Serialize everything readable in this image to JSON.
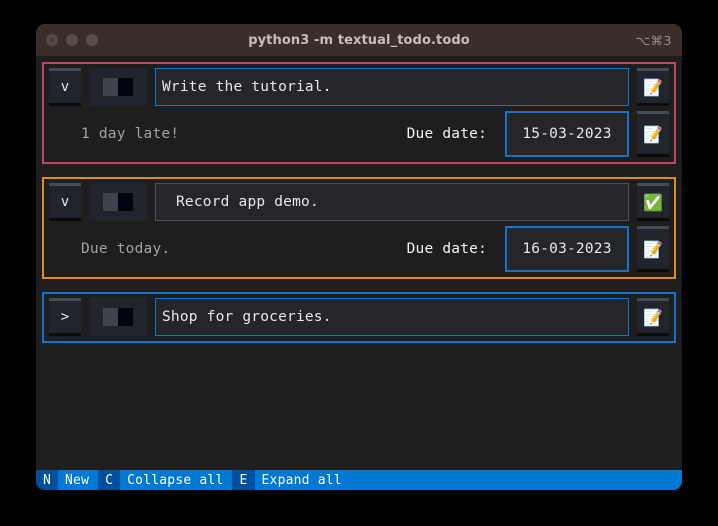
{
  "window": {
    "title": "python3 -m textual_todo.todo",
    "shortcut_hint": "⌥⌘3",
    "traffic_lights": [
      "close-dot",
      "minimize-dot",
      "zoom-dot"
    ]
  },
  "todos": [
    {
      "accent_color": "#c2445f",
      "accent_class": "accent-pink",
      "collapse_arrow": "v",
      "expanded": true,
      "switch_state": "off",
      "description": "Write the tutorial.",
      "description_focused": true,
      "action_icon": "📝",
      "action_icon_name": "memo-icon",
      "status_text": "1 day late!",
      "due_label": "Due date:",
      "due_date": "15-03-2023",
      "row2_action_icon": "📝",
      "row2_action_icon_name": "memo-icon"
    },
    {
      "accent_color": "#e08b1c",
      "accent_class": "accent-orange",
      "collapse_arrow": "v",
      "expanded": true,
      "switch_state": "off",
      "description": "Record app demo.",
      "description_focused": false,
      "action_icon": "✅",
      "action_icon_name": "check-mark-icon",
      "status_text": "Due today.",
      "due_label": "Due date:",
      "due_date": "16-03-2023",
      "row2_action_icon": "📝",
      "row2_action_icon_name": "memo-icon"
    },
    {
      "accent_color": "#1672c8",
      "accent_class": "accent-blue",
      "collapse_arrow": ">",
      "expanded": false,
      "switch_state": "off",
      "description": "Shop for groceries.",
      "description_focused": true,
      "action_icon": "📝",
      "action_icon_name": "memo-icon"
    }
  ],
  "footer": {
    "bindings": [
      {
        "key": "N",
        "description": "New"
      },
      {
        "key": "C",
        "description": "Collapse all"
      },
      {
        "key": "E",
        "description": "Expand all"
      }
    ],
    "key_bg": "#004e9e",
    "bar_bg": "#0178d4"
  }
}
